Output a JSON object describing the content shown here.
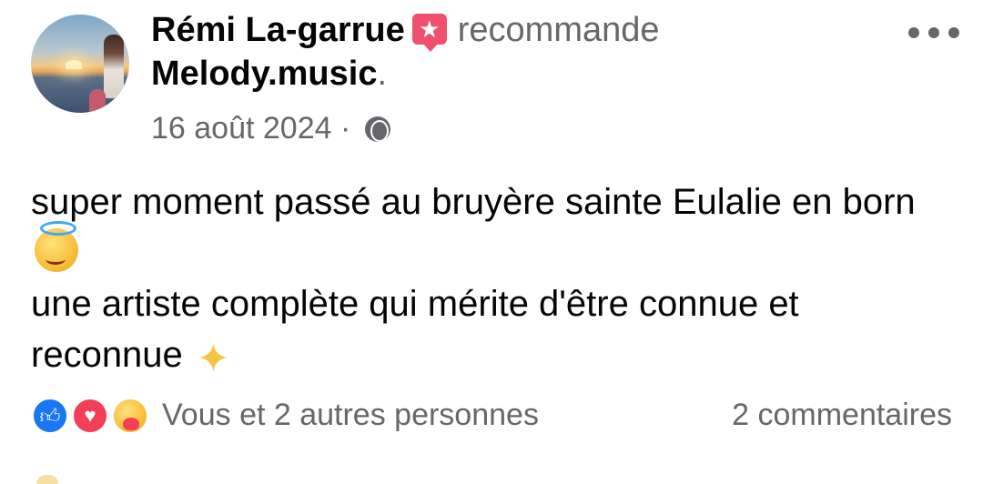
{
  "post": {
    "author": "Rémi La-garrue",
    "recommend_badge_icon": "recommend-star-icon",
    "verb": "recommande",
    "page_name": "Melody.music",
    "page_suffix": ".",
    "date": "16 août 2024",
    "separator": "·",
    "privacy_icon": "globe-icon",
    "more_icon": "more-options-icon",
    "text_lines": [
      "super moment passé au bruyère sainte Eulalie en born",
      "une artiste complète qui mérite d'être connue et reconnue"
    ],
    "emoji_1": "smiling-face-with-halo-icon",
    "emoji_2": "sparkles-icon",
    "reactions": {
      "icons": [
        "like-icon",
        "love-icon",
        "care-icon"
      ],
      "summary": "Vous et 2 autres personnes"
    },
    "comments_count_text": "2 commentaires"
  },
  "colors": {
    "text_primary": "#050505",
    "text_secondary": "#65676b",
    "like_blue": "#1877f2",
    "love_red": "#f33e58",
    "badge_pink": "#f0506e"
  }
}
